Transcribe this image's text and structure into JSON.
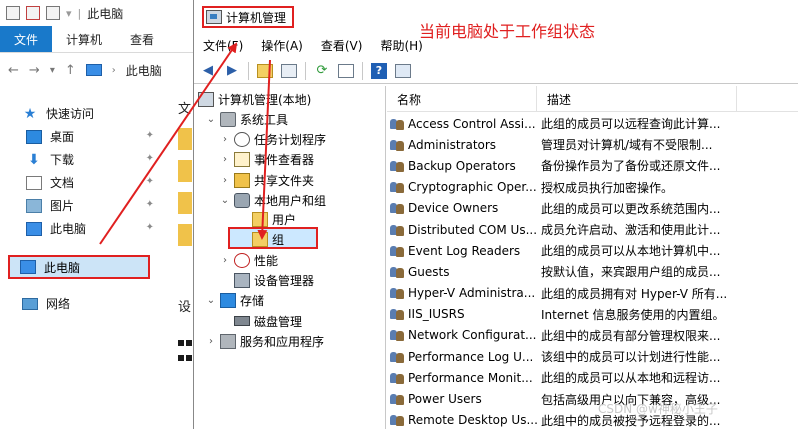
{
  "explorer": {
    "title": "此电脑",
    "ribbon_tabs": [
      "文件",
      "计算机",
      "查看"
    ],
    "nav_location": "此电脑",
    "quick_access": "快速访问",
    "items": [
      "桌面",
      "下载",
      "文档",
      "图片",
      "此电脑"
    ],
    "selected_item": "此电脑",
    "network": "网络",
    "partial_labels": [
      "文",
      "设"
    ]
  },
  "mmc": {
    "title": "计算机管理",
    "annotation": "当前电脑处于工作组状态",
    "menu": [
      "文件(F)",
      "操作(A)",
      "查看(V)",
      "帮助(H)"
    ],
    "tree": {
      "root": "计算机管理(本地)",
      "system_tools": "系统工具",
      "task_scheduler": "任务计划程序",
      "event_viewer": "事件查看器",
      "shared_folders": "共享文件夹",
      "local_users_groups": "本地用户和组",
      "users": "用户",
      "groups": "组",
      "performance": "性能",
      "device_manager": "设备管理器",
      "storage": "存储",
      "disk_management": "磁盘管理",
      "services_apps": "服务和应用程序"
    },
    "list": {
      "columns": [
        "名称",
        "描述"
      ],
      "rows": [
        {
          "name": "Access Control Assi...",
          "desc": "此组的成员可以远程查询此计算..."
        },
        {
          "name": "Administrators",
          "desc": "管理员对计算机/域有不受限制..."
        },
        {
          "name": "Backup Operators",
          "desc": "备份操作员为了备份或还原文件..."
        },
        {
          "name": "Cryptographic Oper...",
          "desc": "授权成员执行加密操作。"
        },
        {
          "name": "Device Owners",
          "desc": "此组的成员可以更改系统范围内..."
        },
        {
          "name": "Distributed COM Us...",
          "desc": "成员允许启动、激活和使用此计..."
        },
        {
          "name": "Event Log Readers",
          "desc": "此组的成员可以从本地计算机中..."
        },
        {
          "name": "Guests",
          "desc": "按默认值，来宾跟用户组的成员..."
        },
        {
          "name": "Hyper-V Administra...",
          "desc": "此组的成员拥有对 Hyper-V 所有..."
        },
        {
          "name": "IIS_IUSRS",
          "desc": "Internet 信息服务使用的内置组。"
        },
        {
          "name": "Network Configurat...",
          "desc": "此组中的成员有部分管理权限来..."
        },
        {
          "name": "Performance Log U...",
          "desc": "该组中的成员可以计划进行性能..."
        },
        {
          "name": "Performance Monit...",
          "desc": "此组的成员可以从本地和远程访..."
        },
        {
          "name": "Power Users",
          "desc": "包括高级用户以向下兼容，高级..."
        },
        {
          "name": "Remote Desktop Us...",
          "desc": "此组中的成员被授予远程登录的..."
        }
      ]
    }
  },
  "watermark": "CSDN @w神秘小王子",
  "colors": {
    "highlight_red": "#e02020",
    "selection_blue": "#cce4f7",
    "file_tab_blue": "#1979ca"
  }
}
